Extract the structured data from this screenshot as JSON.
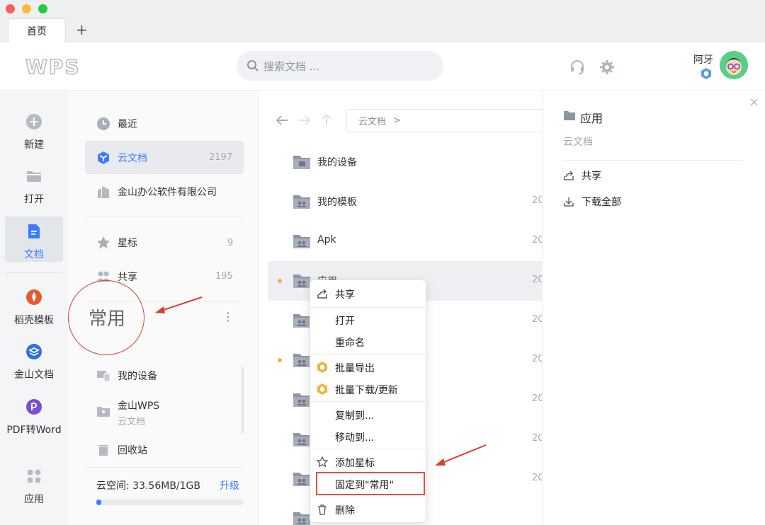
{
  "tabs": {
    "home": "首页",
    "add": "+"
  },
  "header": {
    "logo": "WPS",
    "search_placeholder": "搜索文档 ...",
    "user_name": "阿牙"
  },
  "rail": [
    {
      "label": "新建",
      "icon": "plus-circle-icon"
    },
    {
      "label": "打开",
      "icon": "folder-icon"
    },
    {
      "label": "文档",
      "icon": "document-icon"
    },
    {
      "label": "稻壳模板",
      "icon": "docer-icon"
    },
    {
      "label": "金山文档",
      "icon": "kdocs-icon"
    },
    {
      "label": "PDF转Word",
      "icon": "pdf-icon"
    },
    {
      "label": "应用",
      "icon": "apps-grid-icon"
    }
  ],
  "nav": {
    "recent": "最近",
    "cloud": "云文档",
    "cloud_count": "2197",
    "company": "金山办公软件有限公司",
    "star": "星标",
    "star_count": "9",
    "share": "共享",
    "share_count": "195",
    "frequent": "常用",
    "more": "⋮",
    "my_devices": "我的设备",
    "kingsoft_wps": "金山WPS",
    "kingsoft_wps_sub": "云文档",
    "recycle": "回收站",
    "space": "云空间: 33.56MB/1GB",
    "upgrade": "升级",
    "space_fraction": 0.034
  },
  "breadcrumb": {
    "root": "云文档",
    "sep": ">"
  },
  "files": [
    {
      "name": "我的设备",
      "date": ""
    },
    {
      "name": "我的模板",
      "date": "20"
    },
    {
      "name": "Apk",
      "date": "20"
    },
    {
      "name": "应用",
      "date": "20"
    },
    {
      "name": "",
      "date": "20"
    },
    {
      "name": "",
      "date": "20"
    },
    {
      "name": "",
      "date": "20"
    },
    {
      "name": "",
      "date": "20"
    },
    {
      "name": "",
      "date": "20"
    },
    {
      "name": "",
      "date": ""
    }
  ],
  "panel": {
    "title": "应用",
    "subtitle": "云文档",
    "share": "共享",
    "download_all": "下载全部",
    "close": "×"
  },
  "menu": {
    "share": "共享",
    "open": "打开",
    "rename": "重命名",
    "batch_export": "批量导出",
    "batch_download": "批量下载/更新",
    "copy_to": "复制到...",
    "move_to": "移动到...",
    "add_star": "添加星标",
    "pin": "固定到\"常用\"",
    "delete": "删除"
  },
  "annotation": {
    "label": "常用"
  },
  "colors": {
    "accent": "#3b7cff",
    "annotation": "#d8402d",
    "badge": "#f3b23c"
  }
}
